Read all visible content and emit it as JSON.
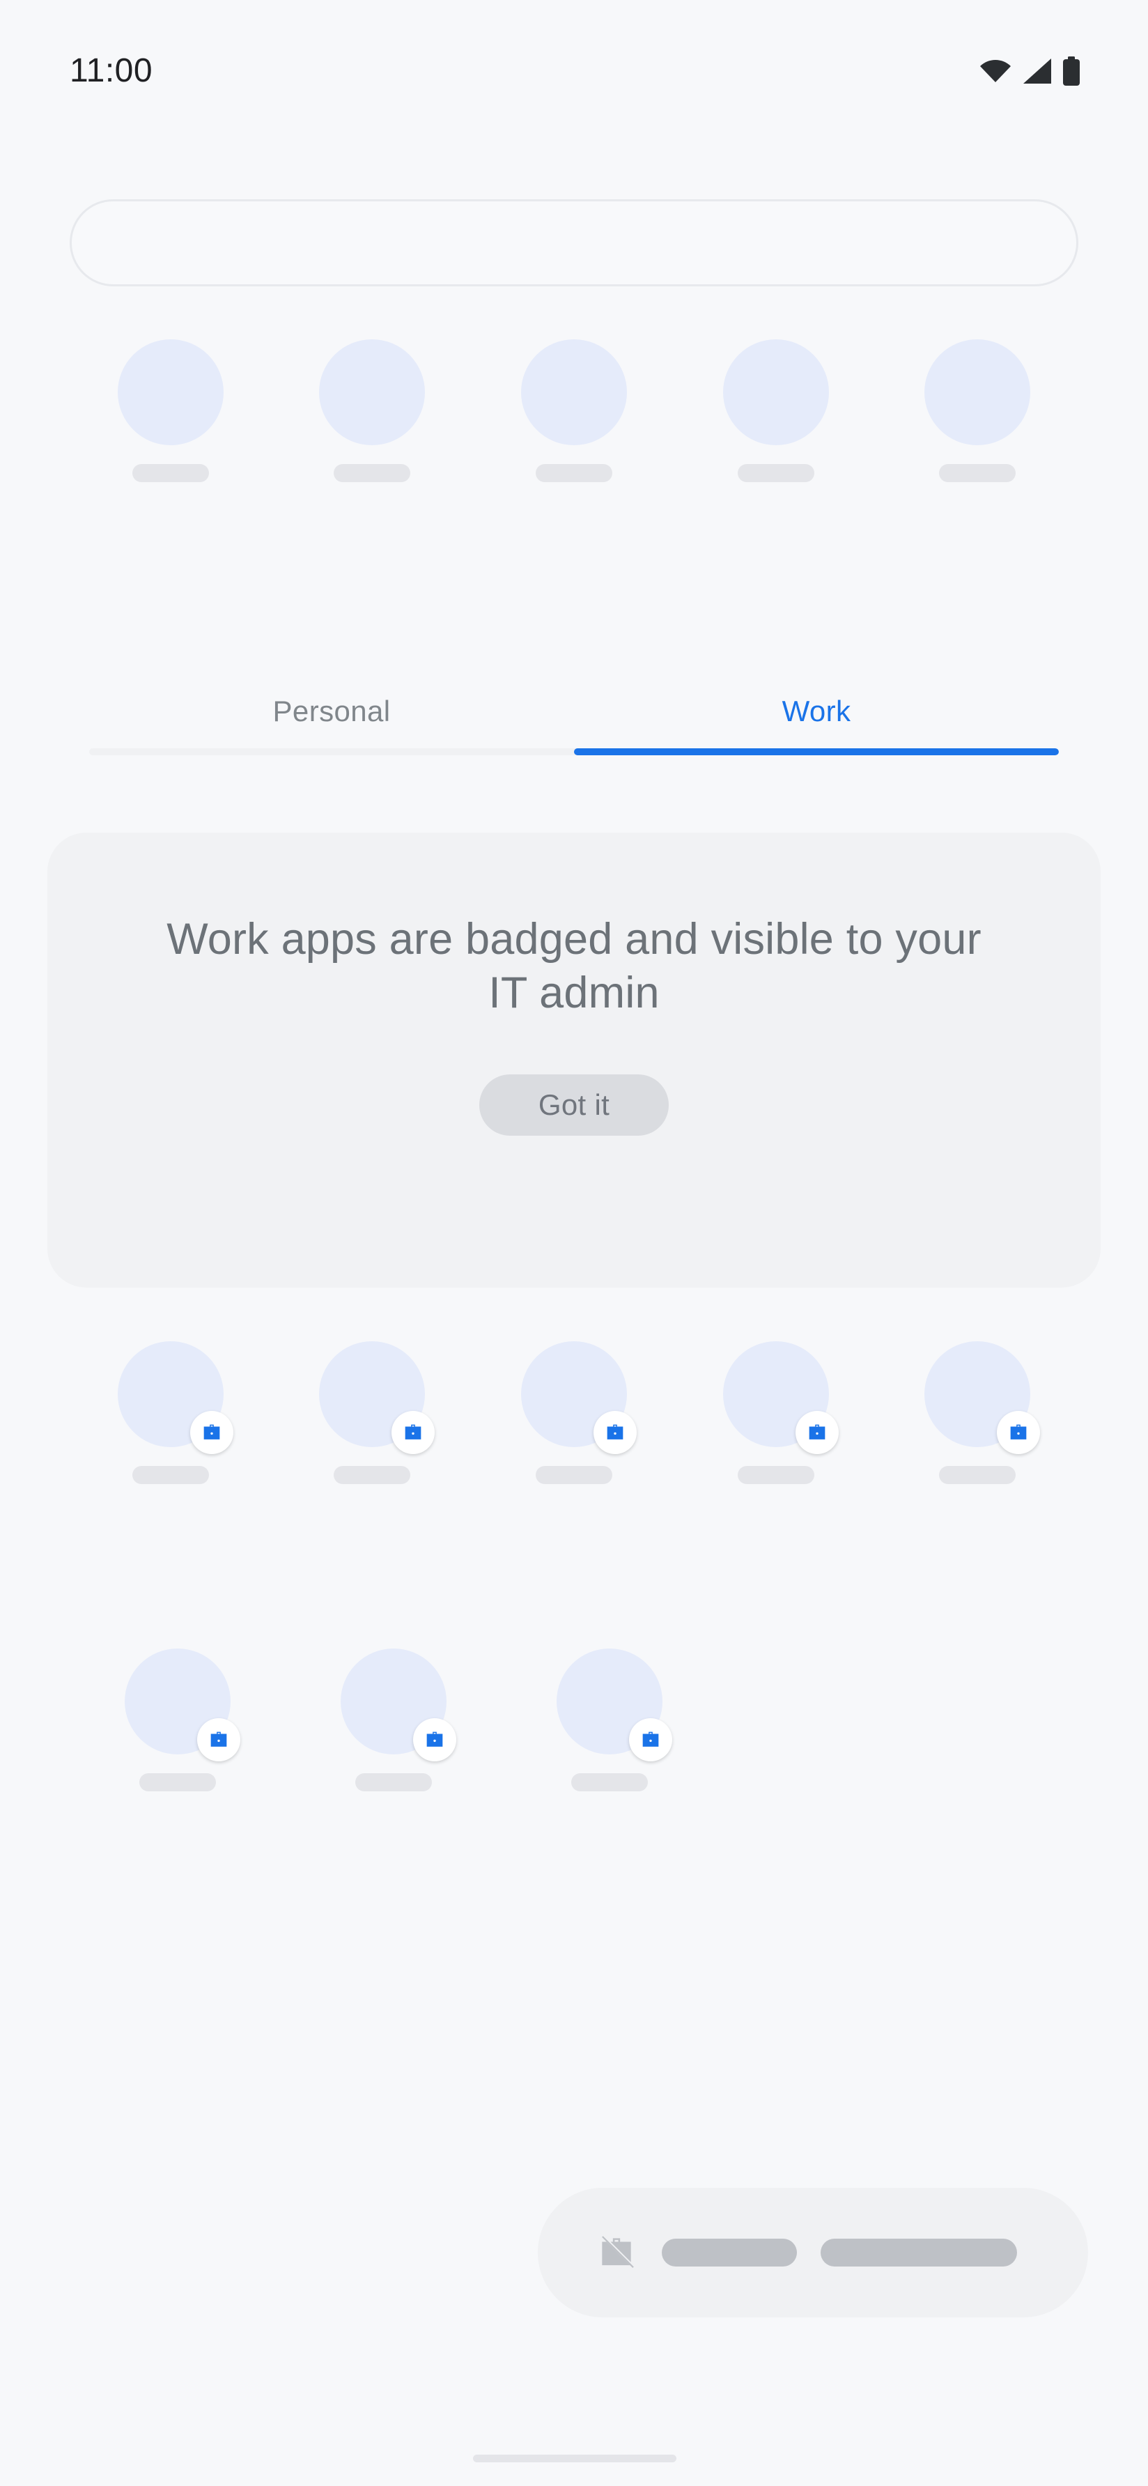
{
  "status_bar": {
    "time": "11:00",
    "icons": [
      "wifi-icon",
      "cellular-signal-icon",
      "battery-icon"
    ]
  },
  "search": {
    "value": "",
    "placeholder": ""
  },
  "suggestions_row": {
    "count": 5,
    "items": [
      {
        "label": "",
        "badged": false
      },
      {
        "label": "",
        "badged": false
      },
      {
        "label": "",
        "badged": false
      },
      {
        "label": "",
        "badged": false
      },
      {
        "label": "",
        "badged": false
      }
    ]
  },
  "tabs": {
    "items": [
      {
        "label": "Personal",
        "active": false
      },
      {
        "label": "Work",
        "active": true
      }
    ],
    "active_index": 1,
    "active_color": "#1A73E8",
    "inactive_color": "#80868B"
  },
  "info_card": {
    "title": "Work apps are badged and visible to your IT admin",
    "button_label": "Got it",
    "background": "#F1F2F4",
    "text_color": "#6C7278",
    "button_background": "#DADCE0",
    "button_text_color": "#70757D"
  },
  "work_apps": {
    "badge_icon": "briefcase-icon",
    "badge_color": "#1A73E8",
    "icon_placeholder_color": "#E5EBFA",
    "label_placeholder_color": "#E4E5E9",
    "row_one": [
      {
        "label": "",
        "badged": true
      },
      {
        "label": "",
        "badged": true
      },
      {
        "label": "",
        "badged": true
      },
      {
        "label": "",
        "badged": true
      },
      {
        "label": "",
        "badged": true
      }
    ],
    "row_two": [
      {
        "label": "",
        "badged": true
      },
      {
        "label": "",
        "badged": true
      },
      {
        "label": "",
        "badged": true
      }
    ]
  },
  "taskbar": {
    "icon": "work-apps-off-icon",
    "background": "#F0F1F3",
    "pill_color": "#BEC1C6",
    "pills": [
      "short",
      "long"
    ]
  },
  "home_indicator": {
    "color": "#E4E5E9"
  },
  "theme": {
    "page_background": "#F7F8FA",
    "accent": "#1A73E8"
  }
}
